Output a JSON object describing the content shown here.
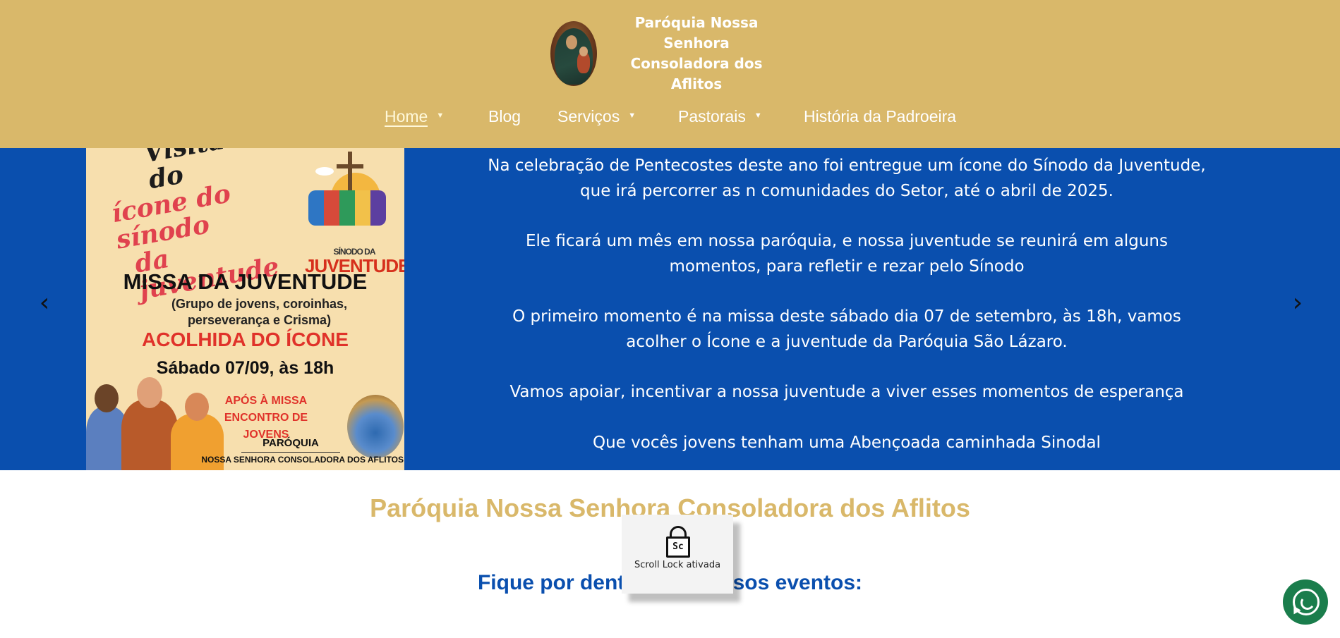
{
  "header": {
    "logo_line1": "Paróquia Nossa Senhora",
    "logo_line2": "Consoladora dos Aflitos",
    "bg_color": "#d9b86a"
  },
  "nav": {
    "items": [
      {
        "label": "Home",
        "has_dropdown": true,
        "active": true
      },
      {
        "label": "Blog",
        "has_dropdown": false
      },
      {
        "label": "Serviços",
        "has_dropdown": true
      },
      {
        "label": "Pastorais",
        "has_dropdown": true
      },
      {
        "label": "História da Padroeira",
        "has_dropdown": false
      }
    ],
    "caret": "▼"
  },
  "slider": {
    "bg_color": "#0a4fae",
    "prev_icon": "‹",
    "next_icon": "›",
    "poster": {
      "visita_l1": "Visita do",
      "visita_l2": "ícone do sínodo",
      "visita_l3": "da juventude",
      "badge_small": "SÍNODO DA",
      "badge_title": "JUVENTUDE",
      "missa": "MISSA DA JUVENTUDE",
      "grupo_l1": "(Grupo de jovens, coroinhas,",
      "grupo_l2": "perseverança e Crisma)",
      "acolhida": "ACOLHIDA DO ÍCONE",
      "sabado": "Sábado 07/09, às 18h",
      "apos_l1": "APÓS À MISSA",
      "apos_l2": "ENCONTRO DE JOVENS",
      "paroquia": "PARÓQUIA",
      "nossa": "NOSSA SENHORA CONSOLADORA DOS AFLITOS"
    },
    "paragraphs": [
      "Na celebração de Pentecostes deste ano foi entregue um ícone do Sínodo da Juventude, que irá percorrer as n comunidades do Setor, até o abril de 2025.",
      "Ele ficará um mês em nossa paróquia, e nossa juventude se reunirá em alguns momentos, para refletir e rezar pelo Sínodo",
      "O primeiro momento é na missa deste sábado dia 07 de setembro,  às 18h, vamos acolher o Ícone e a juventude da Paróquia São Lázaro.",
      "Vamos apoiar, incentivar a nossa juventude a viver esses momentos de esperança",
      "Que vocês jovens tenham uma Abençoada caminhada Sinodal"
    ]
  },
  "content": {
    "title": "Paróquia Nossa Senhora Consoladora dos Aflitos",
    "subtitle": "Fique por dentro dos nossos eventos:",
    "title_color": "#d9b86a",
    "subtitle_color": "#0a4fae"
  },
  "toast": {
    "icon_text": "Sc",
    "label": "Scroll Lock ativada"
  },
  "whatsapp": {
    "icon": "whatsapp-icon",
    "color": "#1a7d4c"
  }
}
